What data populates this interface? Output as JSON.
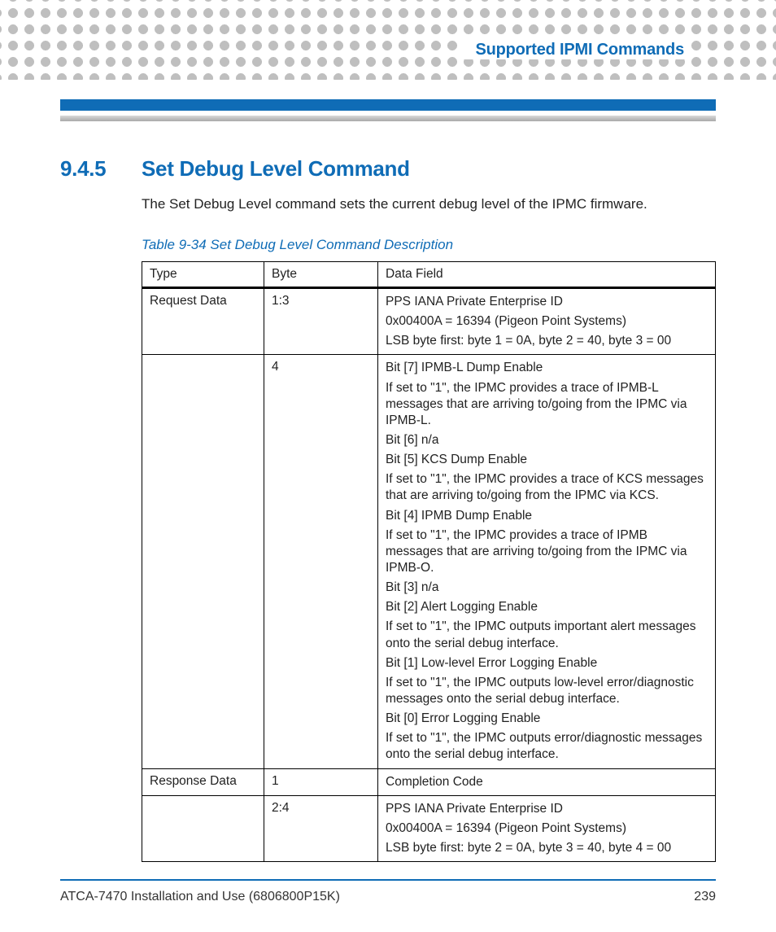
{
  "header": {
    "running_title": "Supported IPMI Commands"
  },
  "section": {
    "number": "9.4.5",
    "title": "Set Debug Level Command",
    "intro": "The Set Debug Level command sets the current debug level of the IPMC firmware."
  },
  "table": {
    "caption": "Table 9-34 Set Debug Level Command Description",
    "headers": {
      "c1": "Type",
      "c2": "Byte",
      "c3": "Data Field"
    },
    "rows": [
      {
        "type": "Request Data",
        "byte": "1:3",
        "data": [
          "PPS IANA Private Enterprise ID",
          "0x00400A = 16394 (Pigeon Point Systems)",
          "LSB byte first: byte 1 = 0A, byte 2 = 40, byte 3 = 00"
        ]
      },
      {
        "type": "",
        "byte": "4",
        "data": [
          "Bit [7] IPMB-L Dump Enable",
          "If set to \"1\", the IPMC provides a trace of IPMB-L messages that are arriving to/going from the IPMC via IPMB-L.",
          "Bit [6] n/a",
          "Bit [5] KCS Dump Enable",
          "If set to \"1\", the IPMC provides a trace of KCS messages that are arriving to/going from the IPMC via KCS.",
          "Bit [4] IPMB Dump Enable",
          "If set to \"1\", the IPMC provides a trace of IPMB messages that are arriving to/going from the IPMC via IPMB-O.",
          "Bit [3] n/a",
          "Bit [2] Alert Logging Enable",
          "If set to \"1\", the IPMC outputs important alert messages onto the serial debug interface.",
          "Bit [1] Low-level Error Logging Enable",
          "If set to \"1\", the IPMC outputs low-level error/diagnostic messages onto the serial debug interface.",
          "Bit [0] Error Logging Enable",
          "If set to \"1\", the IPMC outputs error/diagnostic messages onto the serial debug interface."
        ]
      },
      {
        "type": "Response Data",
        "byte": "1",
        "data": [
          "Completion Code"
        ]
      },
      {
        "type": "",
        "byte": "2:4",
        "data": [
          "PPS IANA Private Enterprise ID",
          "0x00400A = 16394 (Pigeon Point Systems)",
          "LSB byte first: byte 2 = 0A, byte 3 = 40, byte 4 = 00"
        ]
      }
    ]
  },
  "footer": {
    "doc": "ATCA-7470 Installation and Use (6806800P15K)",
    "page": "239"
  }
}
